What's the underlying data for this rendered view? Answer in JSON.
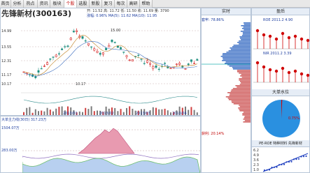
{
  "tabs": [
    "首页",
    "分析",
    "热点",
    "资讯",
    "板块",
    "个股",
    "选股",
    "新股",
    "复习",
    "每次",
    "高研",
    "帮助"
  ],
  "active_tab": 5,
  "stock": {
    "name": "先锋新材",
    "code": "(300163)"
  },
  "kline": {
    "info_line1": "开: 11.52  高: 11.72  低: 11.50  收: 11.69  量: 3790",
    "info_line2": "涨幅: 0.96%  MA(5): 11.62  MA(10): 11.95",
    "price_labels": [
      "14.99",
      "13.55",
      "12.31",
      "11.17",
      "10.17"
    ],
    "high_mark": "15.00",
    "low_mark": "10.17",
    "date_labels": [
      "2013/01",
      "2013/02",
      "2013/03",
      "2013/04"
    ]
  },
  "volume_chart": {
    "title": "大单主力线(30日)",
    "value": "317.23万",
    "y_labels": [
      "1504.07万",
      "283.00万"
    ]
  },
  "realtime": {
    "header": "实时",
    "value_label": "套牢: 78.86%",
    "bottom_label": "获利: 20.14%"
  },
  "right_panel": {
    "header": "盈后",
    "item1": "ROE 2011.2 4.90",
    "item2": "NIR 2011.2 3.39",
    "pie_header": "大单水位",
    "pie_value": "0.75%",
    "bottom_header": "PE-ROE 特种材料  先锋新材",
    "bottom_ticks": [
      "6.2",
      "4.9",
      "3.6",
      "2.3",
      "1.0"
    ]
  },
  "colors": {
    "up": "#d00000",
    "down": "#209080",
    "accent_blue": "#2070c0",
    "pink_fill": "#e89ab0",
    "purple": "#9070c0",
    "pie": "#2a90e0"
  }
}
